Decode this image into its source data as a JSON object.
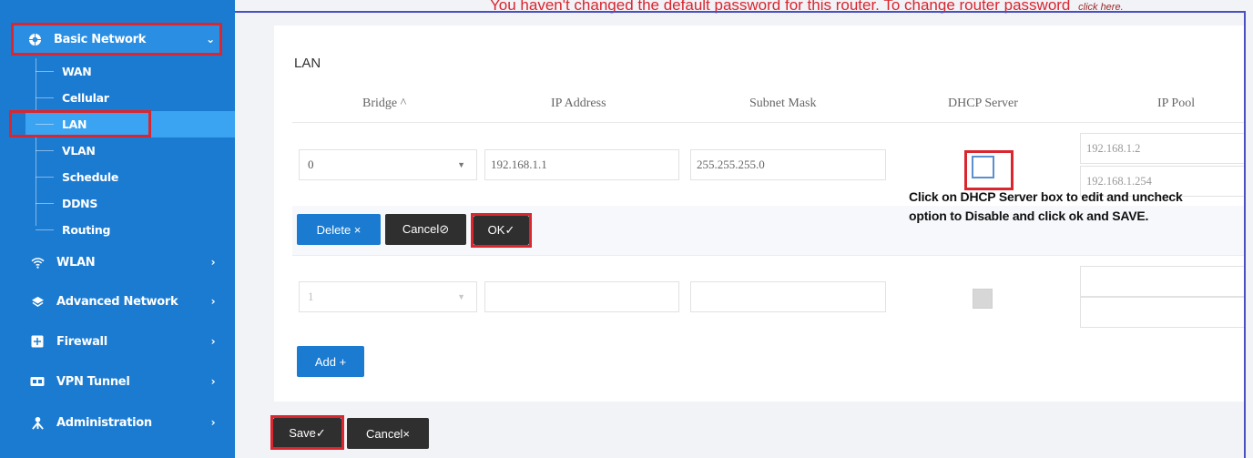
{
  "sidebar": {
    "basic_network": "Basic Network",
    "sub_items": [
      "WAN",
      "Cellular",
      "LAN",
      "VLAN",
      "Schedule",
      "DDNS",
      "Routing"
    ],
    "wlan": "WLAN",
    "advanced_network": "Advanced Network",
    "firewall": "Firewall",
    "vpn_tunnel": "VPN Tunnel",
    "administration": "Administration",
    "chevron_open": "⌄",
    "chevron_closed": "›"
  },
  "warning": {
    "text": "You haven't changed the default password for this router. To change router password",
    "link": "click here."
  },
  "lan": {
    "title": "LAN",
    "headers": {
      "bridge": "Bridge ^",
      "ip_address": "IP Address",
      "subnet_mask": "Subnet Mask",
      "dhcp_server": "DHCP Server",
      "ip_pool": "IP Pool"
    },
    "row1": {
      "bridge": "0",
      "ip_address": "192.168.1.1",
      "subnet_mask": "255.255.255.0",
      "pool_start": "192.168.1.2",
      "pool_end": "192.168.1.254"
    },
    "row2": {
      "bridge": "1"
    },
    "buttons": {
      "delete": "Delete ×",
      "cancel": "Cancel⊘",
      "ok": "OK✓",
      "add": "Add +"
    }
  },
  "note": {
    "line1": "Click on DHCP Server box to edit and uncheck",
    "line2": "option to Disable and click ok and SAVE."
  },
  "footer": {
    "save": "Save✓",
    "cancel": "Cancel×"
  },
  "colors": {
    "sidebar": "#1b7bd1",
    "highlight": "#d9262f",
    "primary_button": "#1b7bd1",
    "dark_button": "#2f2f2f"
  }
}
